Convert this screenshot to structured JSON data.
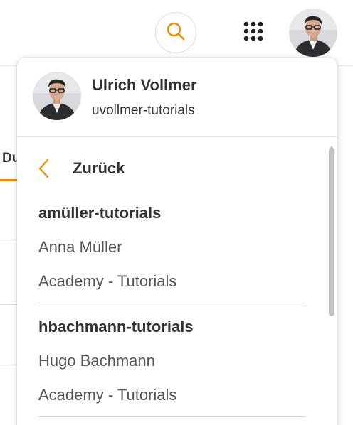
{
  "topbar": {
    "search_icon": "search-icon",
    "apps_icon": "grid-apps-icon",
    "avatar_icon": "user-avatar"
  },
  "background": {
    "tab_label": "Du"
  },
  "user_menu": {
    "name": "Ulrich Vollmer",
    "handle": "uvollmer-tutorials",
    "back_label": "Zurück",
    "back_icon": "chevron-left-icon",
    "accounts": [
      {
        "id": "amüller-tutorials",
        "name": "Anna Müller",
        "org": "Academy - Tutorials"
      },
      {
        "id": "hbachmann-tutorials",
        "name": "Hugo Bachmann",
        "org": "Academy - Tutorials"
      }
    ]
  },
  "colors": {
    "accent": "#f08c00",
    "text": "#333333",
    "muted_text": "#555555"
  }
}
